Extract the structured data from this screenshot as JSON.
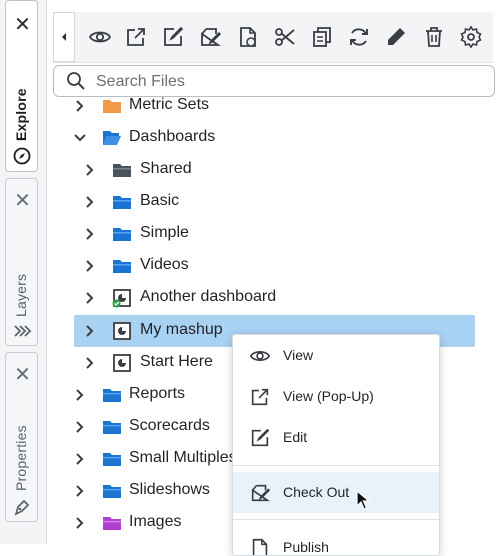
{
  "dock": {
    "tabs": [
      {
        "label": "Explore",
        "close": "✕",
        "icon": "compass-icon",
        "active": true
      },
      {
        "label": "Layers",
        "close": "✕",
        "icon": "layers-icon",
        "active": false
      },
      {
        "label": "Properties",
        "close": "✕",
        "icon": "pen-nib-icon",
        "active": false
      }
    ]
  },
  "toolbar": {
    "collapse_icon": "caret-left-icon",
    "icons": [
      "view-icon",
      "popup-icon",
      "edit-icon",
      "check-out-icon",
      "publish-icon",
      "cut-icon",
      "copy-icon",
      "refresh-icon",
      "rename-icon",
      "delete-icon",
      "settings-icon"
    ]
  },
  "search": {
    "placeholder": "Search Files",
    "value": ""
  },
  "tree": {
    "items": [
      {
        "label": "Metric Sets",
        "icon": "folder-orange-icon"
      },
      {
        "label": "Dashboards",
        "icon": "folder-blue-icon",
        "expanded": true
      },
      {
        "label": "Shared",
        "icon": "folder-dark-icon"
      },
      {
        "label": "Basic",
        "icon": "folder-blue-icon"
      },
      {
        "label": "Simple",
        "icon": "folder-blue-icon"
      },
      {
        "label": "Videos",
        "icon": "folder-blue-icon"
      },
      {
        "label": "Another dashboard",
        "icon": "dashboard-published-icon"
      },
      {
        "label": "My mashup",
        "icon": "dashboard-icon",
        "selected": true
      },
      {
        "label": "Start Here",
        "icon": "dashboard-icon"
      },
      {
        "label": "Reports",
        "icon": "folder-blue-icon"
      },
      {
        "label": "Scorecards",
        "icon": "folder-blue-icon"
      },
      {
        "label": "Small Multiples",
        "icon": "folder-blue-icon"
      },
      {
        "label": "Slideshows",
        "icon": "folder-blue-icon"
      },
      {
        "label": "Images",
        "icon": "folder-purple-icon"
      }
    ]
  },
  "context_menu": {
    "items": [
      {
        "label": "View",
        "icon": "eye-icon"
      },
      {
        "label": "View (Pop-Up)",
        "icon": "external-link-icon"
      },
      {
        "label": "Edit",
        "icon": "edit-icon"
      },
      {
        "label": "Check Out",
        "icon": "check-out-icon",
        "highlighted": true
      },
      {
        "label": "Publish",
        "icon": "publish-icon"
      }
    ]
  },
  "colors": {
    "accent": "#1b73d2",
    "selection": "#a9d1f1",
    "hover": "#e8f2fb"
  }
}
